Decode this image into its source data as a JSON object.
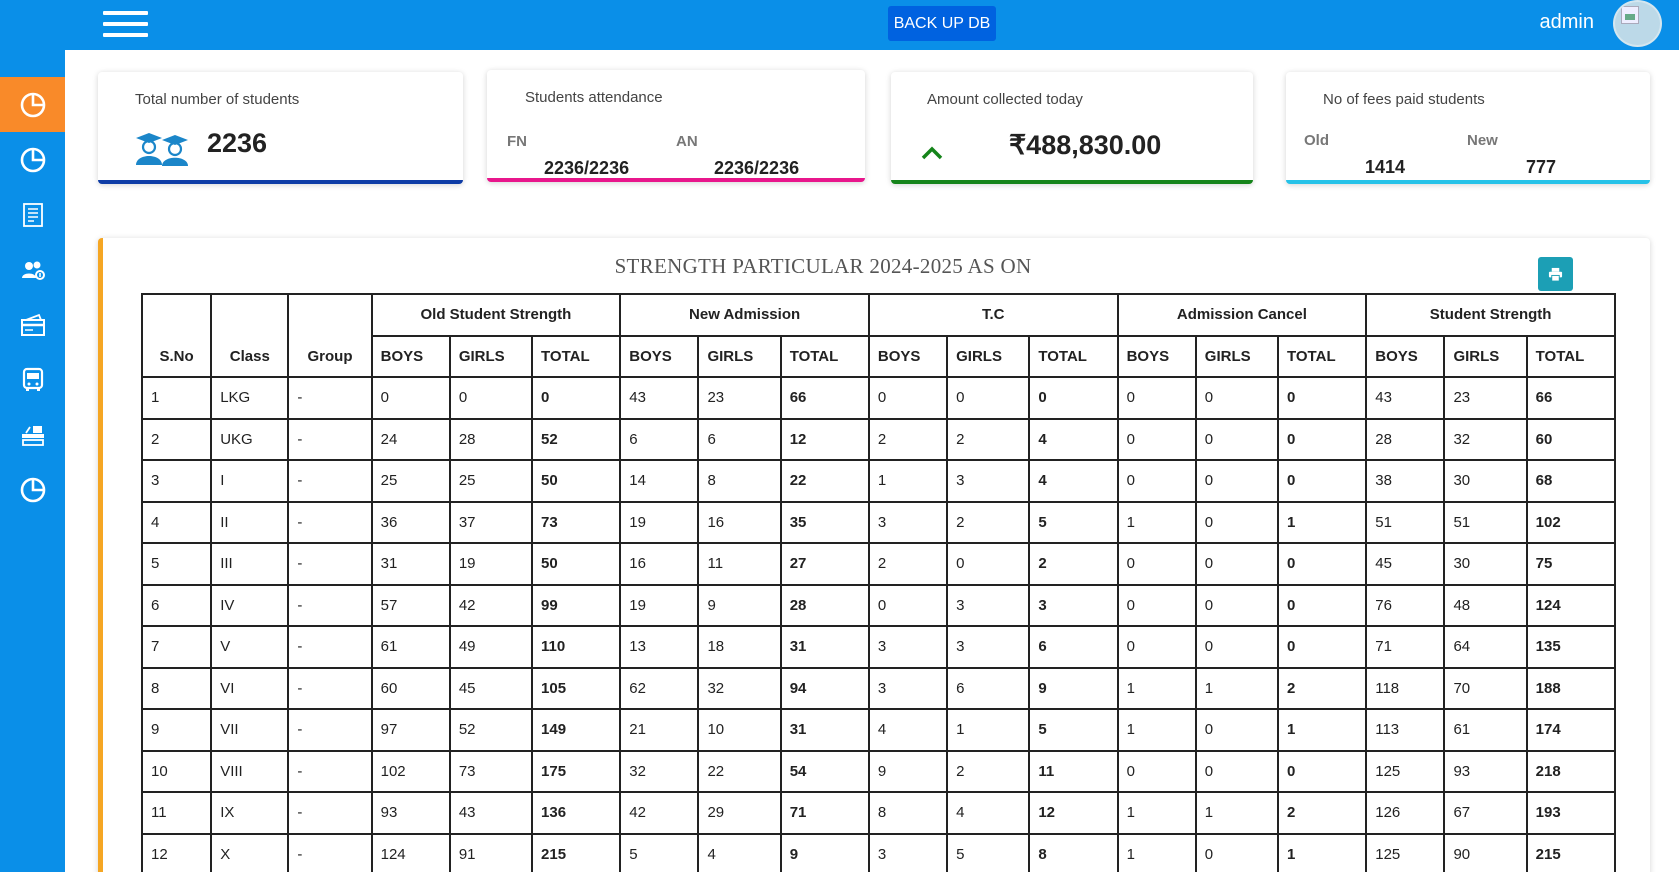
{
  "topbar": {
    "backup_label": "BACK UP DB",
    "user_name": "admin"
  },
  "sidebar": {
    "items": [
      {
        "icon": "pie-chart-icon",
        "active": true
      },
      {
        "icon": "pie-chart-icon",
        "active": false
      },
      {
        "icon": "document-icon",
        "active": false
      },
      {
        "icon": "users-icon",
        "active": false
      },
      {
        "icon": "payment-card-icon",
        "active": false
      },
      {
        "icon": "bus-icon",
        "active": false
      },
      {
        "icon": "desk-icon",
        "active": false
      },
      {
        "icon": "pie-chart-icon",
        "active": false
      }
    ]
  },
  "cards": {
    "total_students": {
      "title": "Total number of students",
      "value": "2236"
    },
    "attendance": {
      "title": "Students attendance",
      "fn_label": "FN",
      "an_label": "AN",
      "fn_value": "2236/2236",
      "an_value": "2236/2236"
    },
    "amount": {
      "title": "Amount collected today",
      "value": "₹488,830.00"
    },
    "fees_paid": {
      "title": "No of fees paid students",
      "old_label": "Old",
      "new_label": "New",
      "old_value": "1414",
      "new_value": "777"
    }
  },
  "colors": {
    "topbar": "#0a8fe8",
    "sidebar_active": "#f98a29",
    "card1_accent": "#0e3ca6",
    "card2_accent": "#e8168c",
    "card3_accent": "#15841a",
    "card4_accent": "#26c2e8",
    "panel_accent": "#f5a623"
  },
  "strength": {
    "title": "STRENGTH PARTICULAR 2024-2025 AS ON",
    "headers": {
      "sno": "S.No",
      "class": "Class",
      "group": "Group",
      "groups": [
        "Old Student Strength",
        "New Admission",
        "T.C",
        "Admission Cancel",
        "Student Strength"
      ],
      "boys": "BOYS",
      "girls": "GIRLS",
      "total": "TOTAL"
    },
    "rows": [
      {
        "sno": "1",
        "class": "LKG",
        "group": "-",
        "v": [
          "0",
          "0",
          "0",
          "43",
          "23",
          "66",
          "0",
          "0",
          "0",
          "0",
          "0",
          "0",
          "43",
          "23",
          "66"
        ]
      },
      {
        "sno": "2",
        "class": "UKG",
        "group": "-",
        "v": [
          "24",
          "28",
          "52",
          "6",
          "6",
          "12",
          "2",
          "2",
          "4",
          "0",
          "0",
          "0",
          "28",
          "32",
          "60"
        ]
      },
      {
        "sno": "3",
        "class": "I",
        "group": "-",
        "v": [
          "25",
          "25",
          "50",
          "14",
          "8",
          "22",
          "1",
          "3",
          "4",
          "0",
          "0",
          "0",
          "38",
          "30",
          "68"
        ]
      },
      {
        "sno": "4",
        "class": "II",
        "group": "-",
        "v": [
          "36",
          "37",
          "73",
          "19",
          "16",
          "35",
          "3",
          "2",
          "5",
          "1",
          "0",
          "1",
          "51",
          "51",
          "102"
        ]
      },
      {
        "sno": "5",
        "class": "III",
        "group": "-",
        "v": [
          "31",
          "19",
          "50",
          "16",
          "11",
          "27",
          "2",
          "0",
          "2",
          "0",
          "0",
          "0",
          "45",
          "30",
          "75"
        ]
      },
      {
        "sno": "6",
        "class": "IV",
        "group": "-",
        "v": [
          "57",
          "42",
          "99",
          "19",
          "9",
          "28",
          "0",
          "3",
          "3",
          "0",
          "0",
          "0",
          "76",
          "48",
          "124"
        ]
      },
      {
        "sno": "7",
        "class": "V",
        "group": "-",
        "v": [
          "61",
          "49",
          "110",
          "13",
          "18",
          "31",
          "3",
          "3",
          "6",
          "0",
          "0",
          "0",
          "71",
          "64",
          "135"
        ]
      },
      {
        "sno": "8",
        "class": "VI",
        "group": "-",
        "v": [
          "60",
          "45",
          "105",
          "62",
          "32",
          "94",
          "3",
          "6",
          "9",
          "1",
          "1",
          "2",
          "118",
          "70",
          "188"
        ]
      },
      {
        "sno": "9",
        "class": "VII",
        "group": "-",
        "v": [
          "97",
          "52",
          "149",
          "21",
          "10",
          "31",
          "4",
          "1",
          "5",
          "1",
          "0",
          "1",
          "113",
          "61",
          "174"
        ]
      },
      {
        "sno": "10",
        "class": "VIII",
        "group": "-",
        "v": [
          "102",
          "73",
          "175",
          "32",
          "22",
          "54",
          "9",
          "2",
          "11",
          "0",
          "0",
          "0",
          "125",
          "93",
          "218"
        ]
      },
      {
        "sno": "11",
        "class": "IX",
        "group": "-",
        "v": [
          "93",
          "43",
          "136",
          "42",
          "29",
          "71",
          "8",
          "4",
          "12",
          "1",
          "1",
          "2",
          "126",
          "67",
          "193"
        ]
      },
      {
        "sno": "12",
        "class": "X",
        "group": "-",
        "v": [
          "124",
          "91",
          "215",
          "5",
          "4",
          "9",
          "3",
          "5",
          "8",
          "1",
          "0",
          "1",
          "125",
          "90",
          "215"
        ]
      }
    ]
  }
}
